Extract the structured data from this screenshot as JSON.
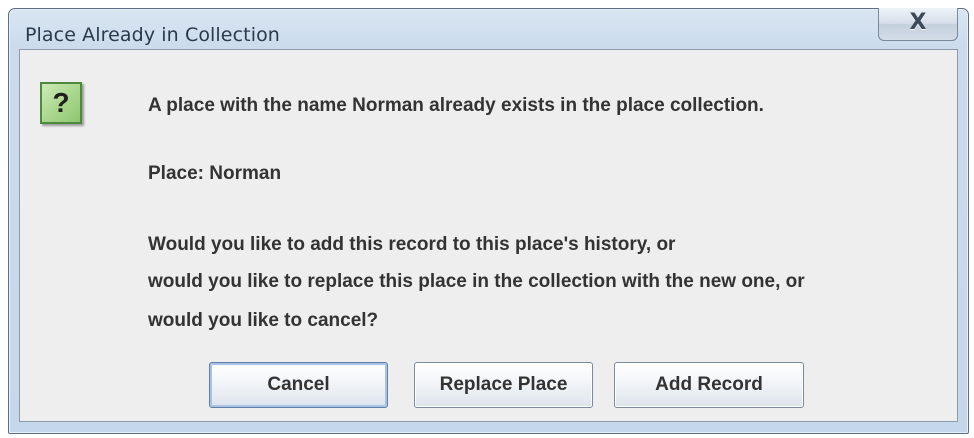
{
  "window": {
    "title": "Place Already in Collection",
    "close_label": "X"
  },
  "icon": {
    "name": "question-icon",
    "glyph": "?",
    "color": "#a8d68c"
  },
  "message": {
    "line1": "A place with the name Norman already exists in the place collection.",
    "line2": "Place: Norman",
    "line3": "Would you like to add this record to this place's history, or",
    "line4": "would you like to replace this place in the collection with the new one, or",
    "line5": "would you like to cancel?"
  },
  "buttons": {
    "cancel": "Cancel",
    "replace": "Replace Place",
    "add": "Add Record"
  }
}
